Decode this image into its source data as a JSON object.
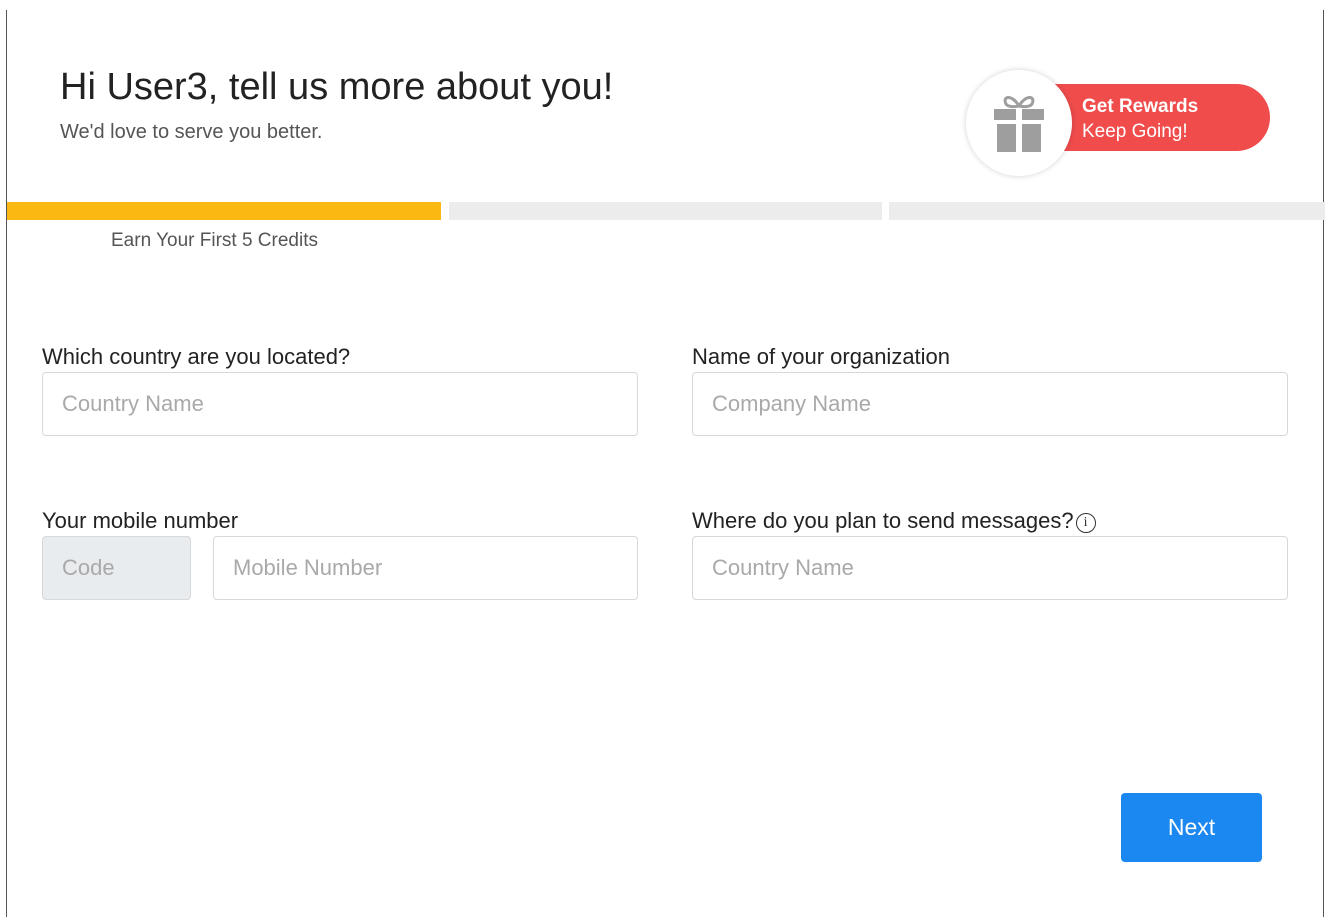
{
  "header": {
    "title": "Hi User3, tell us more about you!",
    "subtitle": "We'd love to serve you better."
  },
  "rewards": {
    "title": "Get Rewards",
    "subtitle": "Keep Going!",
    "icon": "gift-icon",
    "accent_color": "#f04c4c"
  },
  "progress": {
    "steps_total": 3,
    "current_step": 1,
    "label": "Earn Your First 5 Credits",
    "active_color": "#fbb812",
    "inactive_color": "#ececec"
  },
  "form": {
    "country": {
      "label": "Which country are you located?",
      "placeholder": "Country Name",
      "value": ""
    },
    "organization": {
      "label": "Name of your organization",
      "placeholder": "Company Name",
      "value": ""
    },
    "mobile": {
      "label": "Your mobile number",
      "code_placeholder": "Code",
      "number_placeholder": "Mobile Number",
      "value": ""
    },
    "destination": {
      "label": "Where do you plan to send messages?",
      "info_glyph": "i",
      "placeholder": "Country Name",
      "value": ""
    }
  },
  "actions": {
    "next_label": "Next",
    "next_color": "#1a88f0"
  }
}
